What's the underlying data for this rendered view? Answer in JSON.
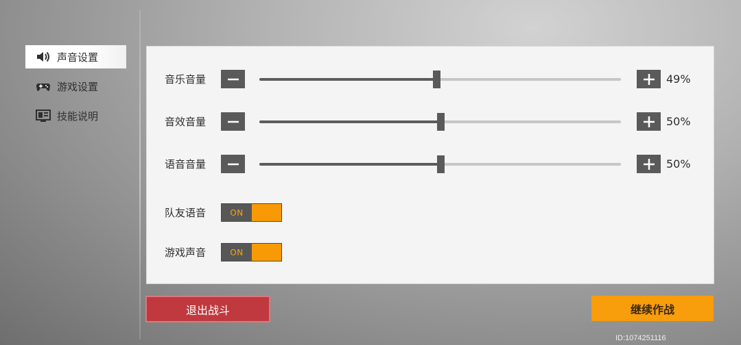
{
  "sidebar": {
    "items": [
      {
        "label": "声音设置",
        "icon": "speaker-icon",
        "active": true
      },
      {
        "label": "游戏设置",
        "icon": "gamepad-icon",
        "active": false
      },
      {
        "label": "技能说明",
        "icon": "skill-screen-icon",
        "active": false
      }
    ]
  },
  "sound": {
    "sliders": [
      {
        "label": "音乐音量",
        "value_text": "49%",
        "value": 0.49
      },
      {
        "label": "音效音量",
        "value_text": "50%",
        "value": 0.5
      },
      {
        "label": "语音音量",
        "value_text": "50%",
        "value": 0.5
      }
    ],
    "toggles": [
      {
        "label": "队友语音",
        "state_text": "ON"
      },
      {
        "label": "游戏声音",
        "state_text": "ON"
      }
    ]
  },
  "actions": {
    "exit_label": "退出战斗",
    "continue_label": "继续作战"
  },
  "footer": {
    "player_id": "ID:1074251116"
  },
  "colors": {
    "accent_orange": "#f89d0b",
    "exit_red": "#c0393e",
    "control_dark": "#5a5a5a"
  }
}
